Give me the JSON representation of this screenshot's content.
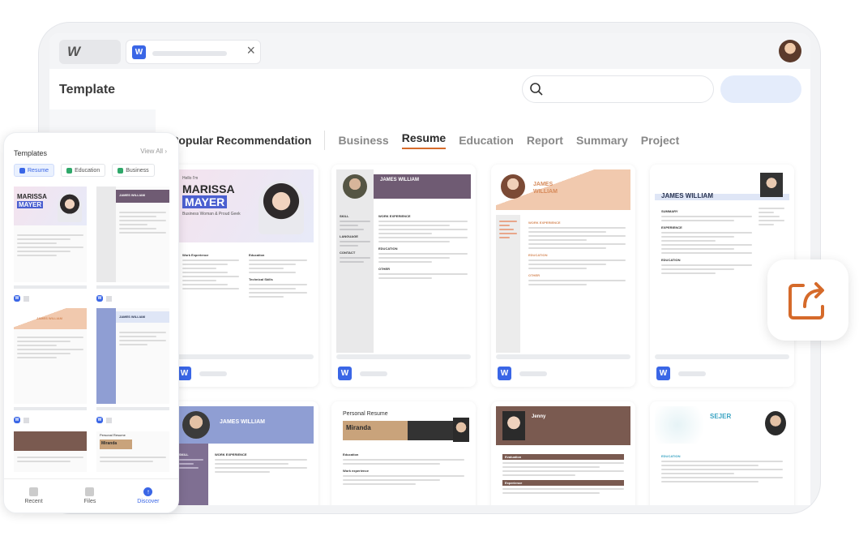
{
  "header": {
    "title": "Template"
  },
  "categories": {
    "popular": "Popular Recommendation",
    "items": [
      "Business",
      "Resume",
      "Education",
      "Report",
      "Summary",
      "Project"
    ],
    "active": "Resume"
  },
  "cards": [
    {
      "name1": "MARISSA",
      "name2": "MAYER",
      "subtitle": "Business Woman & Proud Geek",
      "hello": "Hello I'm",
      "s1": "Work Experience",
      "s2": "Education",
      "s3": "Technical Skills"
    },
    {
      "name": "JAMES WILLIAM",
      "s1": "WORK EXPERIENCE",
      "s2": "EDUCATION",
      "s3": "OTHER",
      "l1": "SKILL",
      "l2": "LANGUAGE",
      "l3": "CONTACT"
    },
    {
      "name": "JAMES WILLIAM",
      "s1": "WORK EXPERIENCE",
      "s2": "EDUCATION",
      "s3": "OTHER"
    },
    {
      "name": "JAMES WILLIAM",
      "s1": "SUMMARY",
      "s2": "EXPERIENCE",
      "s3": "EDUCATION"
    },
    {
      "name": "JAMES WILLIAM",
      "s1": "WORK EXPERIENCE",
      "l1": "SKILL"
    },
    {
      "title": "Personal Resume",
      "name": "Miranda",
      "s1": "Education",
      "s2": "Work experience"
    },
    {
      "name": "Jenny",
      "s1": "Evaluation",
      "s2": "Experience"
    },
    {
      "name": "SEJER",
      "s1": "EDUCATION"
    }
  ],
  "phone": {
    "title": "Templates",
    "view_all": "View All",
    "chips": [
      "Resume",
      "Education",
      "Business"
    ],
    "active_chip": "Resume",
    "nav": [
      "Recent",
      "Files",
      "Discover"
    ],
    "active_nav": "Discover",
    "cards": [
      {
        "name1": "MARISSA",
        "name2": "MAYER"
      },
      {
        "name": "JAMES WILLIAM"
      },
      {
        "name": "JAMES WILLIAM"
      },
      {
        "name": "JAMES WILLIAM"
      },
      {
        "name": ""
      },
      {
        "title": "Personal Resume",
        "name": "Miranda"
      }
    ]
  },
  "colors": {
    "accent": "#d56a2a",
    "brand": "#3a66e6",
    "resume_purple": "#6f5b73",
    "resume_peach": "#e8a68a",
    "resume_blue": "#8f9ed3"
  },
  "icons": {
    "search": "search-icon",
    "share": "share-icon",
    "close": "close-icon"
  }
}
